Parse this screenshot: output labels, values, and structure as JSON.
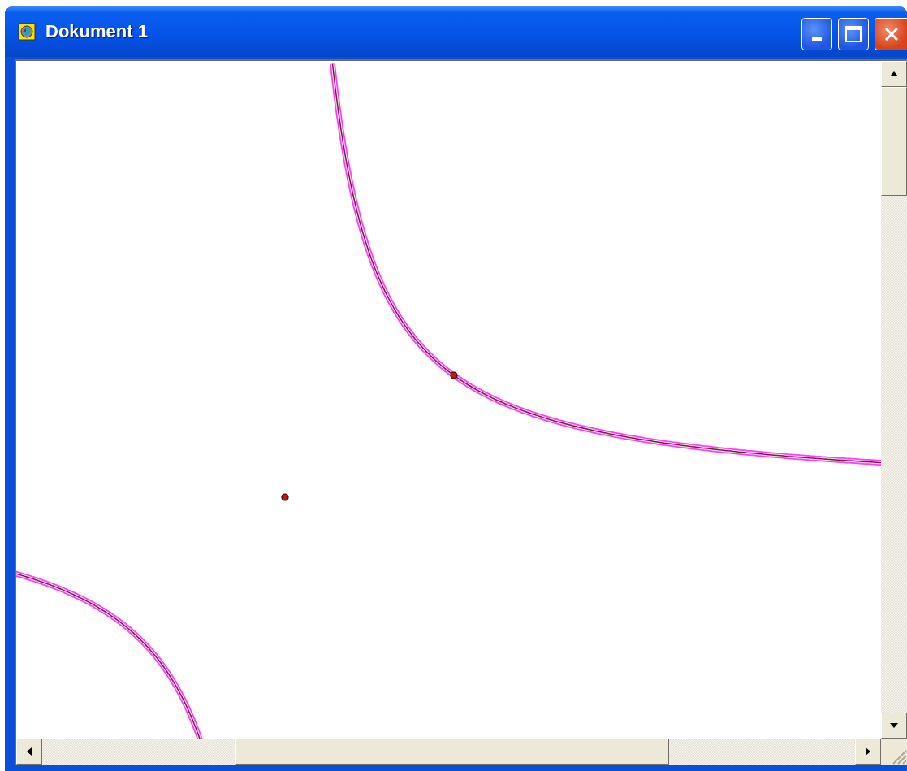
{
  "window": {
    "title": "Dokument 1"
  }
}
